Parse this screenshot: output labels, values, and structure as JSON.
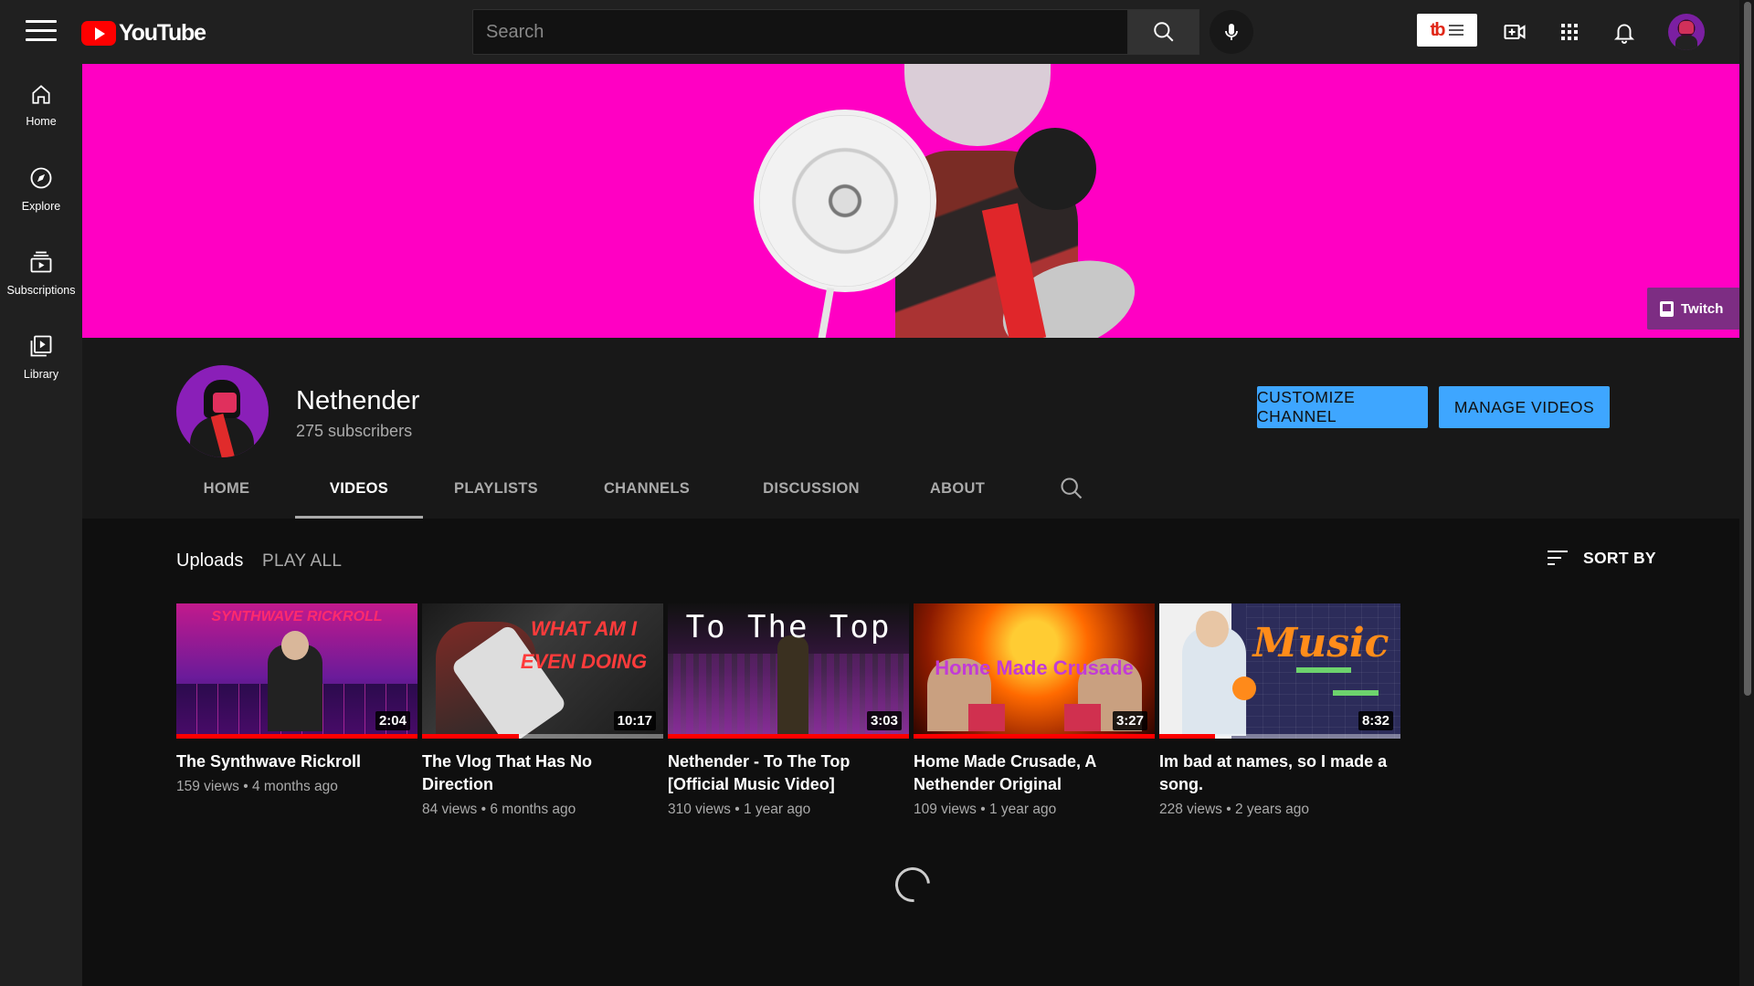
{
  "header": {
    "logo_text": "YouTube",
    "search_placeholder": "Search",
    "icons": [
      "menu-icon",
      "search-icon",
      "mic-icon",
      "create-video-icon",
      "apps-grid-icon",
      "bell-icon"
    ],
    "extension_label": "tb"
  },
  "sidebar": {
    "items": [
      {
        "label": "Home",
        "icon": "home-icon"
      },
      {
        "label": "Explore",
        "icon": "compass-icon"
      },
      {
        "label": "Subscriptions",
        "icon": "subscriptions-icon"
      },
      {
        "label": "Library",
        "icon": "library-icon"
      }
    ]
  },
  "banner": {
    "background": "#ff00c3",
    "links": {
      "twitch": "Twitch"
    }
  },
  "channel": {
    "name": "Nethender",
    "subscribers": "275 subscribers",
    "customize_label": "CUSTOMIZE CHANNEL",
    "manage_label": "MANAGE VIDEOS",
    "accent": "#3ea6ff"
  },
  "tabs": [
    "HOME",
    "VIDEOS",
    "PLAYLISTS",
    "CHANNELS",
    "DISCUSSION",
    "ABOUT"
  ],
  "active_tab": "VIDEOS",
  "uploads": {
    "title": "Uploads",
    "play_all": "PLAY ALL",
    "sort_by": "SORT BY",
    "videos": [
      {
        "title": "The Synthwave Rickroll",
        "views": "159 views",
        "age": "4 months ago",
        "duration": "2:04",
        "thumb_text": "SYNTHWAVE RICKROLL",
        "watched": 1.0
      },
      {
        "title": "The Vlog That Has No Direction",
        "views": "84 views",
        "age": "6 months ago",
        "duration": "10:17",
        "thumb_text": "WHAT AM I EVEN DOING",
        "watched": 0.4
      },
      {
        "title": "Nethender - To The Top [Official Music Video]",
        "views": "310 views",
        "age": "1 year ago",
        "duration": "3:03",
        "thumb_text": "To The Top",
        "watched": 1.0
      },
      {
        "title": "Home Made Crusade, A Nethender Original",
        "views": "109 views",
        "age": "1 year ago",
        "duration": "3:27",
        "thumb_text": "Home Made Crusade",
        "watched": 1.0
      },
      {
        "title": "Im bad at names, so I made a song.",
        "views": "228 views",
        "age": "2 years ago",
        "duration": "8:32",
        "thumb_text": "Music",
        "watched": 0.23
      }
    ]
  }
}
